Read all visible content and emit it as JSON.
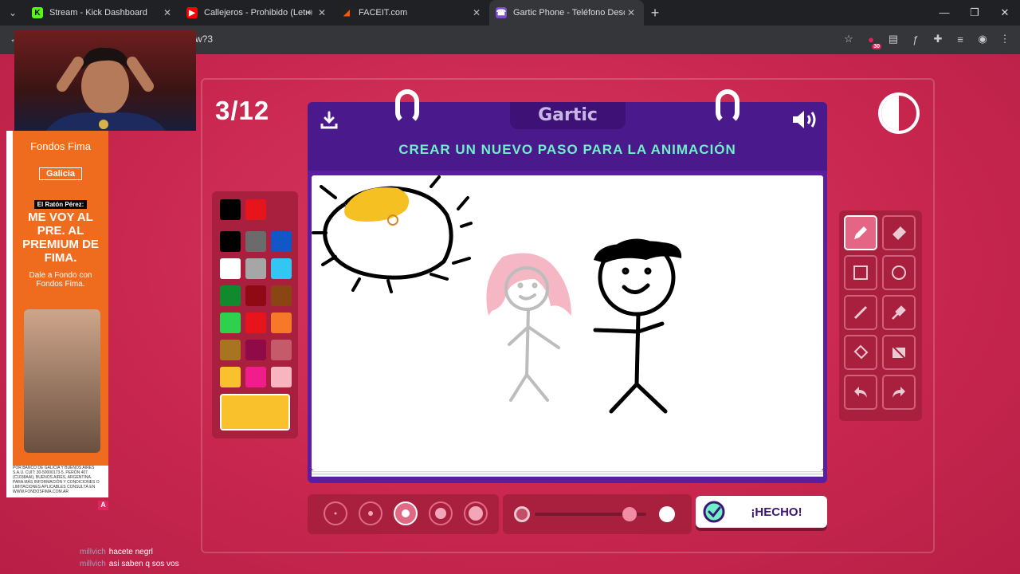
{
  "browser": {
    "tabs": [
      {
        "title": "Stream - Kick Dashboard",
        "favicon": "kick-icon",
        "active": false
      },
      {
        "title": "Callejeros - Prohibido (Letra)",
        "favicon": "youtube-icon",
        "active": false
      },
      {
        "title": "FACEIT.com",
        "favicon": "faceit-icon",
        "active": false
      },
      {
        "title": "Gartic Phone - Teléfono Descon",
        "favicon": "gartic-icon",
        "active": true
      }
    ],
    "url": "w?3",
    "extension_badge": "30"
  },
  "game": {
    "round": "3/12",
    "logo": "Gartic",
    "instruction": "CREAR UN NUEVO PASO PARA LA ANIMACIÓN",
    "done_label": "¡HECHO!",
    "selected_color": "#f9c12c",
    "palette": [
      "#000000",
      "#e8141c",
      "#000000",
      "#6b6b6b",
      "#1256c8",
      "#ffffff",
      "#a6a6a6",
      "#33c6f2",
      "#118a2e",
      "#8f0a14",
      "#8b4513",
      "#2ed14d",
      "#e8141c",
      "#f8782a",
      "#a9741f",
      "#8f0a47",
      "#c55a6a",
      "#f9c12c",
      "#f01d8a",
      "#f8b4bf"
    ],
    "tools": [
      "pencil-icon",
      "eraser-icon",
      "rectangle-icon",
      "ellipse-icon",
      "line-icon",
      "eyedropper-icon",
      "fill-icon",
      "clear-icon",
      "undo-icon",
      "redo-icon"
    ],
    "active_tool": "pencil-icon",
    "brush_sizes": 5,
    "active_brush_size_index": 2,
    "opacity_level": 0.85
  },
  "ad": {
    "brand": "Fondos Fima",
    "bank": "Galicia",
    "tag": "El Ratón Pérez:",
    "headline": "ME VOY AL PRE. AL PREMIUM DE FIMA.",
    "sub": "Dale a Fondo con Fondos Fima.",
    "legal": "POR BANCO DE GALICIA Y BUENOS AIRES S.A.U. CUIT: 30-50000173-5. PERÓN 407 (C1038AAI), BUENOS AIRES, ARGENTINA. PARA MÁS INFORMACIÓN Y CONDICIONES O LIMITACIONES APLICABLES CONSULTÁ EN WWW.FONDOSFIMA.COM.AR",
    "mark": "A"
  },
  "chat": [
    {
      "user": "millvich",
      "message": "hacete negrl"
    },
    {
      "user": "millvich",
      "message": "asi saben q sos vos"
    }
  ]
}
